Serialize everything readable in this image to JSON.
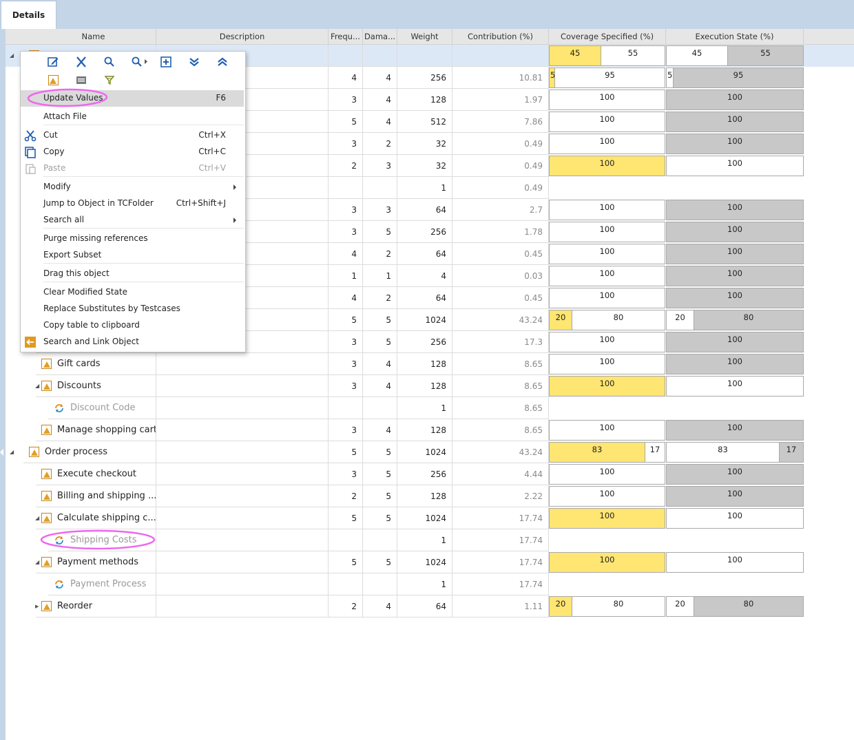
{
  "app": {
    "tab_label": "Details"
  },
  "columns": {
    "name": "Name",
    "description": "Description",
    "frequency": "Frequ...",
    "damage": "Dama...",
    "weight": "Weight",
    "contribution": "Contribution (%)",
    "coverage": "Coverage Specified (%)",
    "execution": "Execution State (%)"
  },
  "colors": {
    "yellow": "#ffe571",
    "gray": "#c8c8c8",
    "selected_row": "#dde8f7",
    "annotation": "#ee66ee",
    "icon_orange": "#e0a020"
  },
  "rows": [
    {
      "name": "",
      "type": "req",
      "level": 0,
      "expander": "expanded",
      "freq": "",
      "dmg": "",
      "weight": "",
      "contrib": "",
      "selected": true,
      "cov": [
        {
          "v": "45",
          "c": "y"
        },
        {
          "v": "55",
          "c": "w"
        }
      ],
      "exe": [
        {
          "v": "45",
          "c": "w"
        },
        {
          "v": "55",
          "c": "g"
        }
      ]
    },
    {
      "name": "",
      "type": "req",
      "level": 1,
      "freq": "4",
      "dmg": "4",
      "weight": "256",
      "contrib": "10.81",
      "cov": [
        {
          "v": "5",
          "c": "y"
        },
        {
          "v": "95",
          "c": "w"
        }
      ],
      "exe": [
        {
          "v": "5",
          "c": "w"
        },
        {
          "v": "95",
          "c": "g"
        }
      ]
    },
    {
      "name": "",
      "type": "req",
      "level": 1,
      "freq": "3",
      "dmg": "4",
      "weight": "128",
      "contrib": "1.97",
      "cov": [
        {
          "v": "100",
          "c": "w"
        }
      ],
      "exe": [
        {
          "v": "100",
          "c": "g"
        }
      ]
    },
    {
      "name": "",
      "type": "req",
      "level": 1,
      "freq": "5",
      "dmg": "4",
      "weight": "512",
      "contrib": "7.86",
      "cov": [
        {
          "v": "100",
          "c": "w"
        }
      ],
      "exe": [
        {
          "v": "100",
          "c": "g"
        }
      ]
    },
    {
      "name": "",
      "type": "req",
      "level": 1,
      "freq": "3",
      "dmg": "2",
      "weight": "32",
      "contrib": "0.49",
      "cov": [
        {
          "v": "100",
          "c": "w"
        }
      ],
      "exe": [
        {
          "v": "100",
          "c": "g"
        }
      ]
    },
    {
      "name": "",
      "type": "req",
      "level": 1,
      "freq": "2",
      "dmg": "3",
      "weight": "32",
      "contrib": "0.49",
      "cov": [
        {
          "v": "100",
          "c": "y"
        }
      ],
      "exe": [
        {
          "v": "100",
          "c": "w"
        }
      ]
    },
    {
      "name": "",
      "type": "link",
      "level": 2,
      "freq": "",
      "dmg": "",
      "weight": "1",
      "contrib": "0.49",
      "cov": [],
      "exe": []
    },
    {
      "name": "",
      "type": "req",
      "level": 1,
      "freq": "3",
      "dmg": "3",
      "weight": "64",
      "contrib": "2.7",
      "cov": [
        {
          "v": "100",
          "c": "w"
        }
      ],
      "exe": [
        {
          "v": "100",
          "c": "g"
        }
      ]
    },
    {
      "name": "",
      "type": "req",
      "level": 1,
      "freq": "3",
      "dmg": "5",
      "weight": "256",
      "contrib": "1.78",
      "cov": [
        {
          "v": "100",
          "c": "w"
        }
      ],
      "exe": [
        {
          "v": "100",
          "c": "g"
        }
      ]
    },
    {
      "name": "",
      "type": "req",
      "level": 1,
      "freq": "4",
      "dmg": "2",
      "weight": "64",
      "contrib": "0.45",
      "cov": [
        {
          "v": "100",
          "c": "w"
        }
      ],
      "exe": [
        {
          "v": "100",
          "c": "g"
        }
      ]
    },
    {
      "name": "",
      "type": "req",
      "level": 1,
      "freq": "1",
      "dmg": "1",
      "weight": "4",
      "contrib": "0.03",
      "cov": [
        {
          "v": "100",
          "c": "w"
        }
      ],
      "exe": [
        {
          "v": "100",
          "c": "g"
        }
      ]
    },
    {
      "name": "",
      "type": "req",
      "level": 1,
      "freq": "4",
      "dmg": "2",
      "weight": "64",
      "contrib": "0.45",
      "cov": [
        {
          "v": "100",
          "c": "w"
        }
      ],
      "exe": [
        {
          "v": "100",
          "c": "g"
        }
      ]
    },
    {
      "name": "",
      "type": "req",
      "level": 0,
      "freq": "5",
      "dmg": "5",
      "weight": "1024",
      "contrib": "43.24",
      "cov": [
        {
          "v": "20",
          "c": "y"
        },
        {
          "v": "80",
          "c": "w"
        }
      ],
      "exe": [
        {
          "v": "20",
          "c": "w"
        },
        {
          "v": "80",
          "c": "g"
        }
      ]
    },
    {
      "name": "",
      "type": "req",
      "level": 1,
      "freq": "3",
      "dmg": "5",
      "weight": "256",
      "contrib": "17.3",
      "cov": [
        {
          "v": "100",
          "c": "w"
        }
      ],
      "exe": [
        {
          "v": "100",
          "c": "g"
        }
      ]
    },
    {
      "name": "Gift cards",
      "type": "req",
      "level": 1,
      "freq": "3",
      "dmg": "4",
      "weight": "128",
      "contrib": "8.65",
      "cov": [
        {
          "v": "100",
          "c": "w"
        }
      ],
      "exe": [
        {
          "v": "100",
          "c": "g"
        }
      ]
    },
    {
      "name": "Discounts",
      "type": "req",
      "level": 1,
      "expander": "expanded",
      "freq": "3",
      "dmg": "4",
      "weight": "128",
      "contrib": "8.65",
      "cov": [
        {
          "v": "100",
          "c": "y"
        }
      ],
      "exe": [
        {
          "v": "100",
          "c": "w"
        }
      ]
    },
    {
      "name": "Discount Code",
      "type": "link",
      "level": 2,
      "freq": "",
      "dmg": "",
      "weight": "1",
      "contrib": "8.65",
      "cov": [],
      "exe": []
    },
    {
      "name": "Manage shopping cart",
      "type": "req",
      "level": 1,
      "freq": "3",
      "dmg": "4",
      "weight": "128",
      "contrib": "8.65",
      "cov": [
        {
          "v": "100",
          "c": "w"
        }
      ],
      "exe": [
        {
          "v": "100",
          "c": "g"
        }
      ]
    },
    {
      "name": "Order process",
      "type": "req",
      "level": 0,
      "expander": "expanded",
      "freq": "5",
      "dmg": "5",
      "weight": "1024",
      "contrib": "43.24",
      "cov": [
        {
          "v": "83",
          "c": "y"
        },
        {
          "v": "17",
          "c": "w"
        }
      ],
      "exe": [
        {
          "v": "83",
          "c": "w"
        },
        {
          "v": "17",
          "c": "g"
        }
      ]
    },
    {
      "name": "Execute checkout",
      "type": "req",
      "level": 1,
      "freq": "3",
      "dmg": "5",
      "weight": "256",
      "contrib": "4.44",
      "cov": [
        {
          "v": "100",
          "c": "w"
        }
      ],
      "exe": [
        {
          "v": "100",
          "c": "g"
        }
      ]
    },
    {
      "name": "Billing and shipping ...",
      "type": "req",
      "level": 1,
      "freq": "2",
      "dmg": "5",
      "weight": "128",
      "contrib": "2.22",
      "cov": [
        {
          "v": "100",
          "c": "w"
        }
      ],
      "exe": [
        {
          "v": "100",
          "c": "g"
        }
      ]
    },
    {
      "name": "Calculate shipping c...",
      "type": "req",
      "level": 1,
      "expander": "expanded",
      "freq": "5",
      "dmg": "5",
      "weight": "1024",
      "contrib": "17.74",
      "cov": [
        {
          "v": "100",
          "c": "y"
        }
      ],
      "exe": [
        {
          "v": "100",
          "c": "w"
        }
      ]
    },
    {
      "name": "Shipping Costs",
      "type": "link",
      "level": 2,
      "freq": "",
      "dmg": "",
      "weight": "1",
      "contrib": "17.74",
      "cov": [],
      "exe": []
    },
    {
      "name": "Payment methods",
      "type": "req",
      "level": 1,
      "expander": "expanded",
      "freq": "5",
      "dmg": "5",
      "weight": "1024",
      "contrib": "17.74",
      "cov": [
        {
          "v": "100",
          "c": "y"
        }
      ],
      "exe": [
        {
          "v": "100",
          "c": "w"
        }
      ]
    },
    {
      "name": "Payment Process",
      "type": "link",
      "level": 2,
      "freq": "",
      "dmg": "",
      "weight": "1",
      "contrib": "17.74",
      "cov": [],
      "exe": []
    },
    {
      "name": "Reorder",
      "type": "req",
      "level": 1,
      "expander": "collapsed",
      "freq": "2",
      "dmg": "4",
      "weight": "64",
      "contrib": "1.11",
      "cov": [
        {
          "v": "20",
          "c": "y"
        },
        {
          "v": "80",
          "c": "w"
        }
      ],
      "exe": [
        {
          "v": "20",
          "c": "w"
        },
        {
          "v": "80",
          "c": "g"
        }
      ]
    }
  ],
  "context_menu": {
    "toolbar_icons": [
      "edit-icon",
      "cut-tool-icon",
      "search-icon",
      "search-options-icon",
      "expand-icon",
      "collapse-all-icon",
      "expand-all-icon",
      "requirement-icon",
      "folder-icon",
      "filter-icon"
    ],
    "items": [
      {
        "label": "Update Values",
        "shortcut": "F6",
        "highlighted": true
      },
      {
        "label": "Attach File"
      },
      {
        "label": "Cut",
        "shortcut": "Ctrl+X",
        "icon": "scissors-icon"
      },
      {
        "label": "Copy",
        "shortcut": "Ctrl+C",
        "icon": "copy-icon"
      },
      {
        "label": "Paste",
        "shortcut": "Ctrl+V",
        "icon": "paste-icon",
        "disabled": true
      },
      {
        "label": "Modify",
        "submenu": true
      },
      {
        "label": "Jump to Object in TCFolder",
        "shortcut": "Ctrl+Shift+J"
      },
      {
        "label": "Search all",
        "submenu": true
      },
      {
        "label": "Purge missing references"
      },
      {
        "label": "Export Subset"
      },
      {
        "label": "Drag this object"
      },
      {
        "label": "Clear Modified State"
      },
      {
        "label": "Replace Substitutes by Testcases"
      },
      {
        "label": "Copy table to clipboard"
      },
      {
        "label": "Search and Link Object",
        "icon": "link-arrow-icon"
      }
    ]
  }
}
